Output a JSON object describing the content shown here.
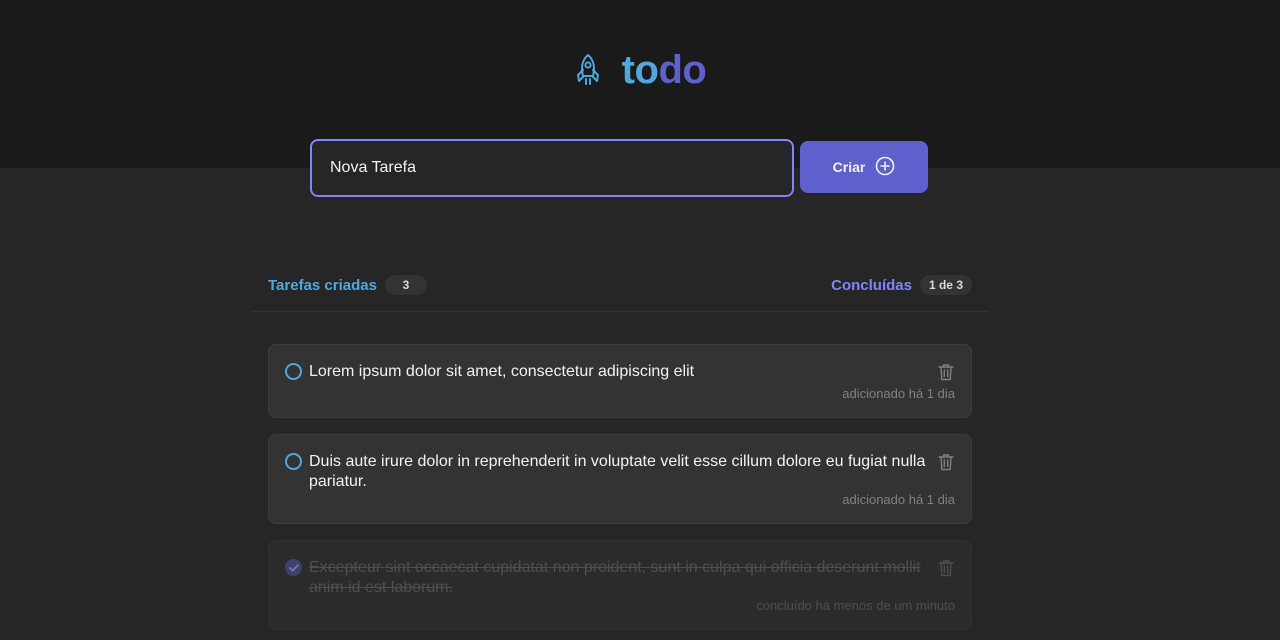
{
  "app": {
    "logo_part1": "to",
    "logo_part2": "do",
    "icon": "rocket-icon",
    "colors": {
      "blue": "#4ea8de",
      "purple": "#5e60ce",
      "purple_light": "#8284fa"
    }
  },
  "form": {
    "input_value": "Nova Tarefa",
    "create_label": "Criar",
    "create_icon": "plus-circle-icon"
  },
  "counters": {
    "created_label": "Tarefas criadas",
    "created_count": "3",
    "done_label": "Concluídas",
    "done_count": "1 de 3"
  },
  "tasks": [
    {
      "text": "Lorem ipsum dolor sit amet, consectetur adipiscing elit",
      "meta": "adicionado há 1 dia",
      "completed": false
    },
    {
      "text": "Duis aute irure dolor in reprehenderit in voluptate velit esse cillum dolore eu fugiat nulla pariatur.",
      "meta": "adicionado há 1 dia",
      "completed": false
    },
    {
      "text": "Excepteur sint occaecat cupidatat non proident, sunt in culpa qui officia deserunt mollit anim id est laborum.",
      "meta": "concluído há menos de um minuto",
      "completed": true
    }
  ]
}
